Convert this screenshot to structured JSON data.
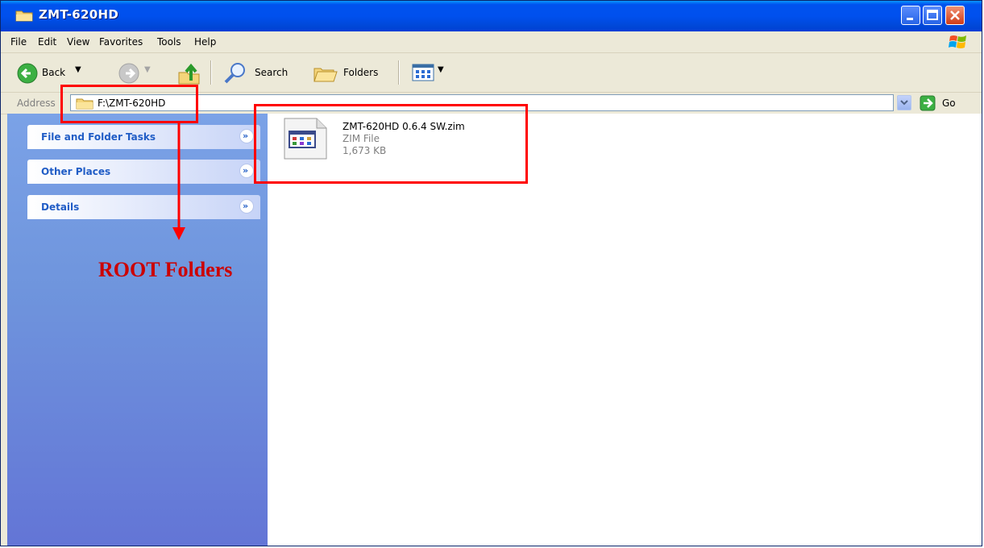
{
  "window": {
    "title": "ZMT-620HD"
  },
  "menu": {
    "items": [
      "File",
      "Edit",
      "View",
      "Favorites",
      "Tools",
      "Help"
    ]
  },
  "toolbar": {
    "back_label": "Back",
    "search_label": "Search",
    "folders_label": "Folders"
  },
  "address": {
    "label": "Address",
    "value": "F:\\ZMT-620HD",
    "go_label": "Go"
  },
  "tasks": {
    "panels": [
      {
        "title": "File and Folder Tasks"
      },
      {
        "title": "Other Places"
      },
      {
        "title": "Details"
      }
    ]
  },
  "files": [
    {
      "name": "ZMT-620HD 0.6.4 SW.zim",
      "type": "ZIM File",
      "size": "1,673 KB"
    }
  ],
  "annotation": {
    "text": "ROOT Folders",
    "color": "#cc0000"
  },
  "colors": {
    "titlebar": "#0053ee",
    "task_pane": "#6f95dd",
    "task_title": "#215dc6",
    "highlight": "#ff0000"
  }
}
